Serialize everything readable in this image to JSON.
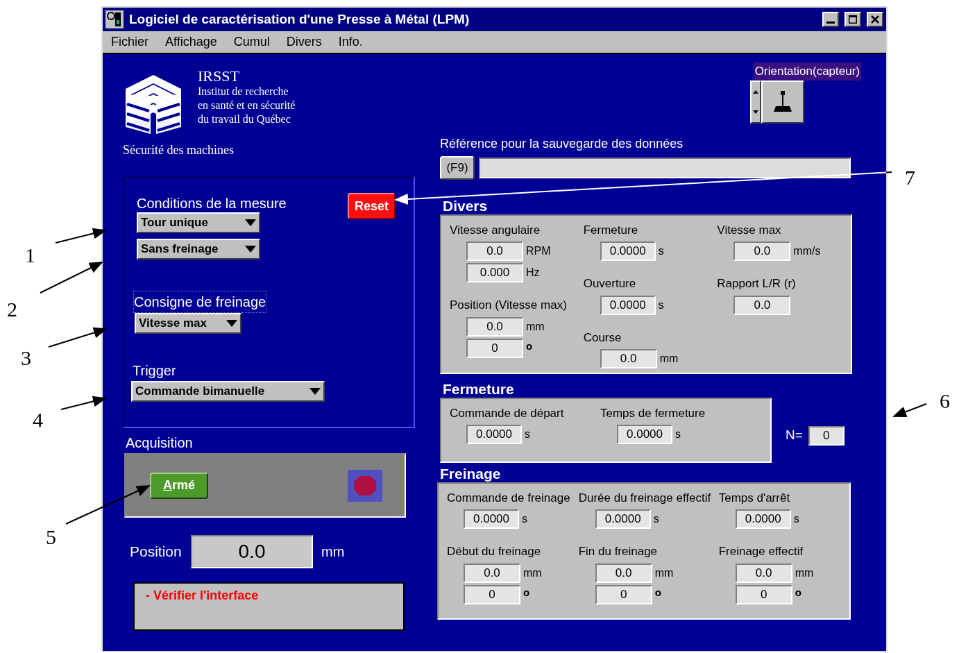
{
  "window": {
    "title": "Logiciel de caractérisation d'une Presse à Métal (LPM)"
  },
  "menu": [
    "Fichier",
    "Affichage",
    "Cumul",
    "Divers",
    "Info."
  ],
  "logo": {
    "acronym": "IRSST",
    "lines": [
      "Institut de recherche",
      "en santé et en sécurité",
      "du travail du Québec"
    ],
    "tagline": "Sécurité des machines"
  },
  "orientation": {
    "label": "Orientation(capteur)"
  },
  "reference": {
    "label": "Référence pour la sauvegarde des données",
    "button": "(F9)"
  },
  "conditions": {
    "title": "Conditions de la mesure",
    "reset": "Reset",
    "dropdowns": [
      "Tour unique",
      "Sans freinage"
    ]
  },
  "consigne": {
    "label": "Consigne de freinage",
    "value": "Vitesse max"
  },
  "trigger": {
    "label": "Trigger",
    "value": "Commande bimanuelle"
  },
  "acquisition": {
    "label": "Acquisition",
    "arm_button": "Armé"
  },
  "position": {
    "label": "Position",
    "value": "0.0",
    "unit": "mm"
  },
  "message": "- Vérifier l'interface",
  "sections": [
    {
      "title": "Divers",
      "columns": [
        [
          {
            "label": "Vitesse angulaire",
            "fields": [
              {
                "value": "0.0",
                "unit": "RPM"
              },
              {
                "value": "0.000",
                "unit": "Hz"
              }
            ]
          },
          {
            "label": "Position (Vitesse max)",
            "fields": [
              {
                "value": "0.0",
                "unit": "mm"
              },
              {
                "value": "0",
                "unit": "o"
              }
            ]
          }
        ],
        [
          {
            "label": "Fermeture",
            "fields": [
              {
                "value": "0.0000",
                "unit": "s"
              }
            ]
          },
          {
            "label": "Ouverture",
            "fields": [
              {
                "value": "0.0000",
                "unit": "s"
              }
            ]
          },
          {
            "label": "Course",
            "fields": [
              {
                "value": "0.0",
                "unit": "mm"
              }
            ]
          }
        ],
        [
          {
            "label": "Vitesse max",
            "fields": [
              {
                "value": "0.0",
                "unit": "mm/s"
              }
            ]
          },
          {
            "label": "Rapport L/R (r)",
            "fields": [
              {
                "value": "0.0"
              }
            ]
          }
        ]
      ]
    },
    {
      "title": "Fermeture",
      "columns": [
        [
          {
            "label": "Commande de départ",
            "fields": [
              {
                "value": "0.0000",
                "unit": "s"
              }
            ]
          }
        ],
        [
          {
            "label": "Temps de fermeture",
            "fields": [
              {
                "value": "0.0000",
                "unit": "s"
              }
            ]
          }
        ]
      ]
    },
    {
      "title": "Freinage",
      "columns": [
        [
          {
            "label": "Commande de freinage",
            "fields": [
              {
                "value": "0.0000",
                "unit": "s"
              }
            ]
          },
          {
            "label": "Début du freinage",
            "fields": [
              {
                "value": "0.0",
                "unit": "mm"
              },
              {
                "value": "0",
                "unit": "o"
              }
            ]
          }
        ],
        [
          {
            "label": "Durée du freinage effectif",
            "fields": [
              {
                "value": "0.0000",
                "unit": "s"
              }
            ]
          },
          {
            "label": "Fin du freinage",
            "fields": [
              {
                "value": "0.0",
                "unit": "mm"
              },
              {
                "value": "0",
                "unit": "o"
              }
            ]
          }
        ],
        [
          {
            "label": "Temps d'arrêt",
            "fields": [
              {
                "value": "0.0000",
                "unit": "s"
              }
            ]
          },
          {
            "label": "Freinage effectif",
            "fields": [
              {
                "value": "0.0",
                "unit": "mm"
              },
              {
                "value": "0",
                "unit": "o"
              }
            ]
          }
        ]
      ]
    }
  ],
  "counter": {
    "label": "N=",
    "value": "0"
  },
  "annotations": [
    {
      "label": "1"
    },
    {
      "label": "2"
    },
    {
      "label": "3"
    },
    {
      "label": "4"
    },
    {
      "label": "5"
    },
    {
      "label": "6"
    },
    {
      "label": "7"
    }
  ]
}
